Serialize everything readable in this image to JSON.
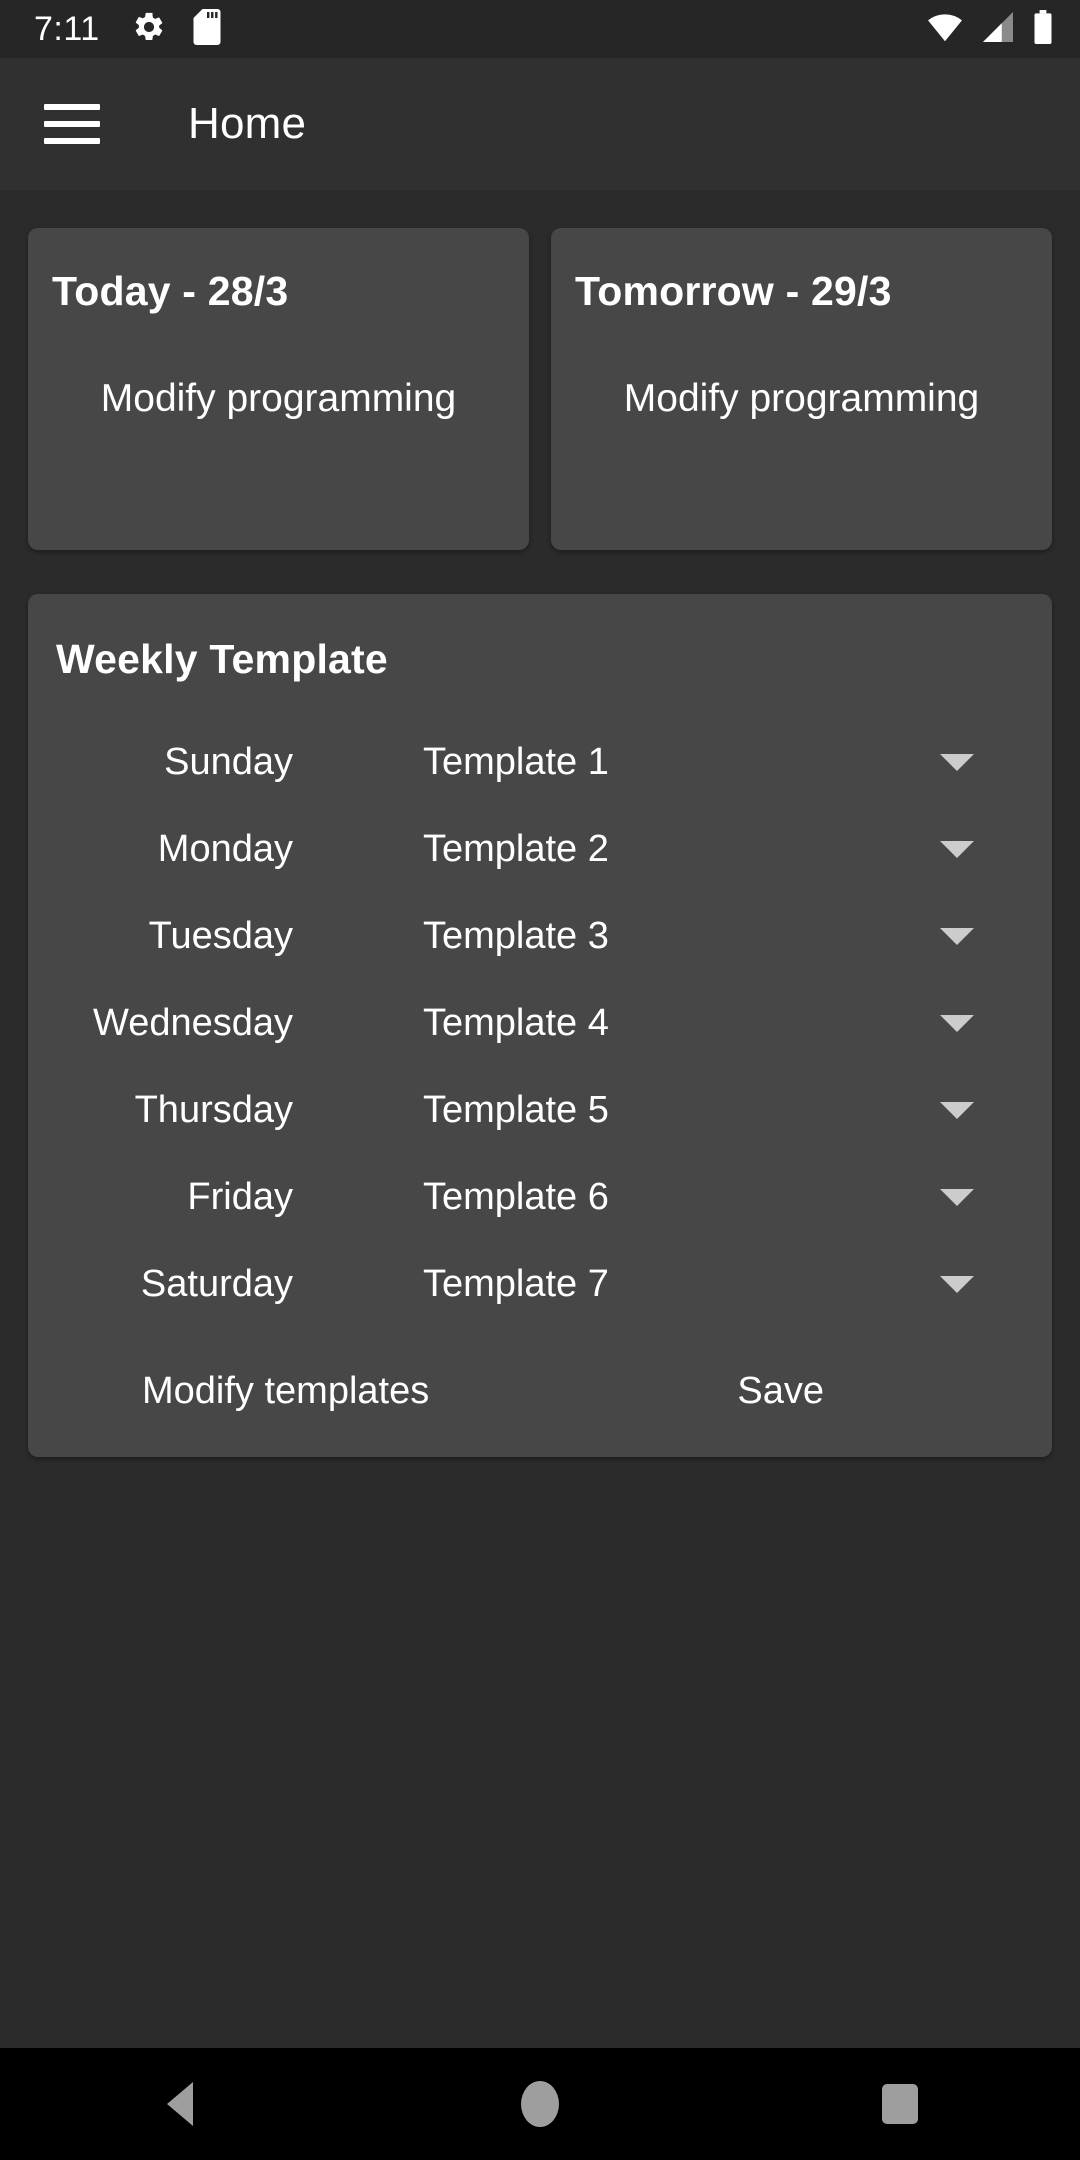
{
  "status_bar": {
    "clock": "7:11",
    "left_icons": [
      "gear-icon",
      "sd-card-icon"
    ],
    "right_icons": [
      "wifi-icon",
      "cellular-signal-icon",
      "battery-icon"
    ]
  },
  "app_bar": {
    "menu_icon": "hamburger-menu-icon",
    "title": "Home"
  },
  "day_cards": [
    {
      "title": "Today - 28/3",
      "action_label": "Modify programming"
    },
    {
      "title": "Tomorrow - 29/3",
      "action_label": "Modify programming"
    }
  ],
  "weekly_template": {
    "title": "Weekly Template",
    "rows": [
      {
        "day": "Sunday",
        "template": "Template 1",
        "arrow_icon": "chevron-down-icon"
      },
      {
        "day": "Monday",
        "template": "Template 2",
        "arrow_icon": "chevron-down-icon"
      },
      {
        "day": "Tuesday",
        "template": "Template 3",
        "arrow_icon": "chevron-down-icon"
      },
      {
        "day": "Wednesday",
        "template": "Template 4",
        "arrow_icon": "chevron-down-icon"
      },
      {
        "day": "Thursday",
        "template": "Template 5",
        "arrow_icon": "chevron-down-icon"
      },
      {
        "day": "Friday",
        "template": "Template 6",
        "arrow_icon": "chevron-down-icon"
      },
      {
        "day": "Saturday",
        "template": "Template 7",
        "arrow_icon": "chevron-down-icon"
      }
    ],
    "modify_templates_label": "Modify templates",
    "save_label": "Save"
  },
  "nav_bar": {
    "back_icon": "back-triangle-icon",
    "home_icon": "home-circle-icon",
    "recents_icon": "recents-square-icon"
  },
  "colors": {
    "screen_background": "#2b2b2b",
    "status_bar_background": "#262626",
    "app_bar_background": "#303030",
    "card_background": "#474747",
    "text_primary": "#ffffff",
    "arrow_gray": "#cccccc",
    "nav_icon_gray": "#9e9e9e",
    "nav_bar_background": "#000000"
  }
}
